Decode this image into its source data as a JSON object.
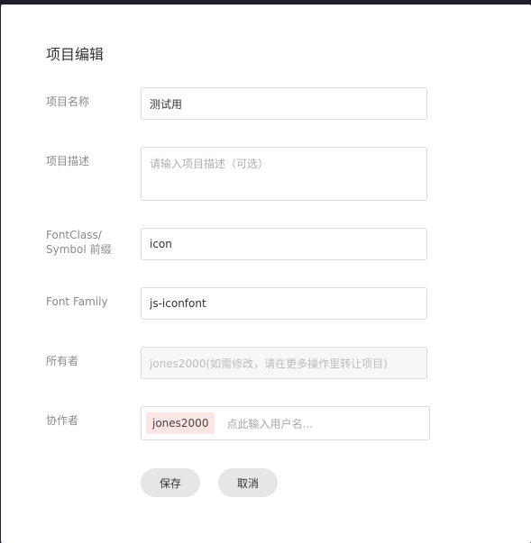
{
  "dialog": {
    "title": "项目编辑"
  },
  "form": {
    "name_label": "项目名称",
    "name_value": "测试用",
    "desc_label": "项目描述",
    "desc_placeholder": "请输入项目描述（可选）",
    "prefix_label_line1": "FontClass/",
    "prefix_label_line2": "Symbol 前缀",
    "prefix_value": "icon",
    "family_label": "Font Family",
    "family_value": "js-iconfont",
    "owner_label": "所有者",
    "owner_value": "jones2000(如需修改，请在更多操作里转让项目)",
    "collab_label": "协作者",
    "collab_tags": [
      "jones2000"
    ],
    "collab_placeholder": "点此输入用户名..."
  },
  "actions": {
    "save_label": "保存",
    "cancel_label": "取消"
  }
}
